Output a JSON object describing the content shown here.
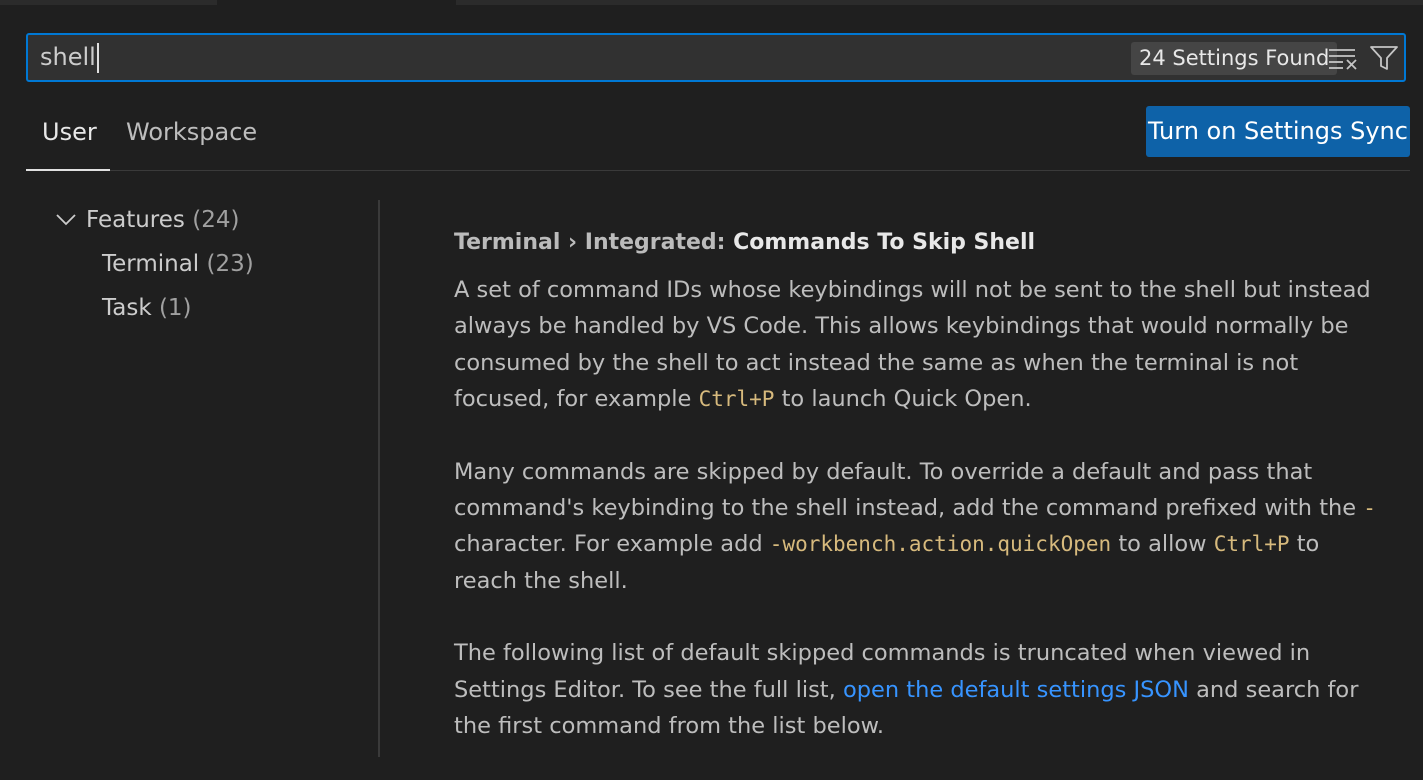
{
  "search": {
    "value": "shell",
    "results_count": "24 Settings Found",
    "clear_icon": "clear-filter-icon",
    "filter_icon": "filter-icon"
  },
  "tabs": [
    {
      "label": "User",
      "active": true
    },
    {
      "label": "Workspace",
      "active": false
    }
  ],
  "sync_button": {
    "label": "Turn on Settings Sync"
  },
  "toc": {
    "features": {
      "label": "Features",
      "count": "(24)",
      "icon": "chevron-down-icon"
    },
    "terminal": {
      "label": "Terminal",
      "count": "(23)"
    },
    "task": {
      "label": "Task",
      "count": "(1)"
    }
  },
  "setting": {
    "category": "Terminal › Integrated: ",
    "name": "Commands To Skip Shell",
    "p1": {
      "text_a": "A set of command IDs whose keybindings will not be sent to the shell but instead always be handled by VS Code. This allows keybindings that would normally be consumed by the shell to act instead the same as when the terminal is not focused, for example ",
      "code_a": "Ctrl+P",
      "text_b": " to launch Quick Open."
    },
    "p2": {
      "text_a": "Many commands are skipped by default. To override a default and pass that command's keybinding to the shell instead, add the command prefixed with the ",
      "code_a": "-",
      "text_b": " character. For example add ",
      "code_b": "-workbench.action.quickOpen",
      "text_c": " to allow ",
      "code_c": "Ctrl+P",
      "text_d": " to reach the shell."
    },
    "p3": {
      "text_a": "The following list of default skipped commands is truncated when viewed in Settings Editor. To see the full list, ",
      "link": "open the default settings JSON",
      "text_b": " and search for the first command from the list below."
    }
  },
  "colors": {
    "background": "#1f1f1f",
    "accent": "#0078d4",
    "sync_button": "#0e62a8",
    "code": "#d7ba7d",
    "link": "#3794ff"
  }
}
